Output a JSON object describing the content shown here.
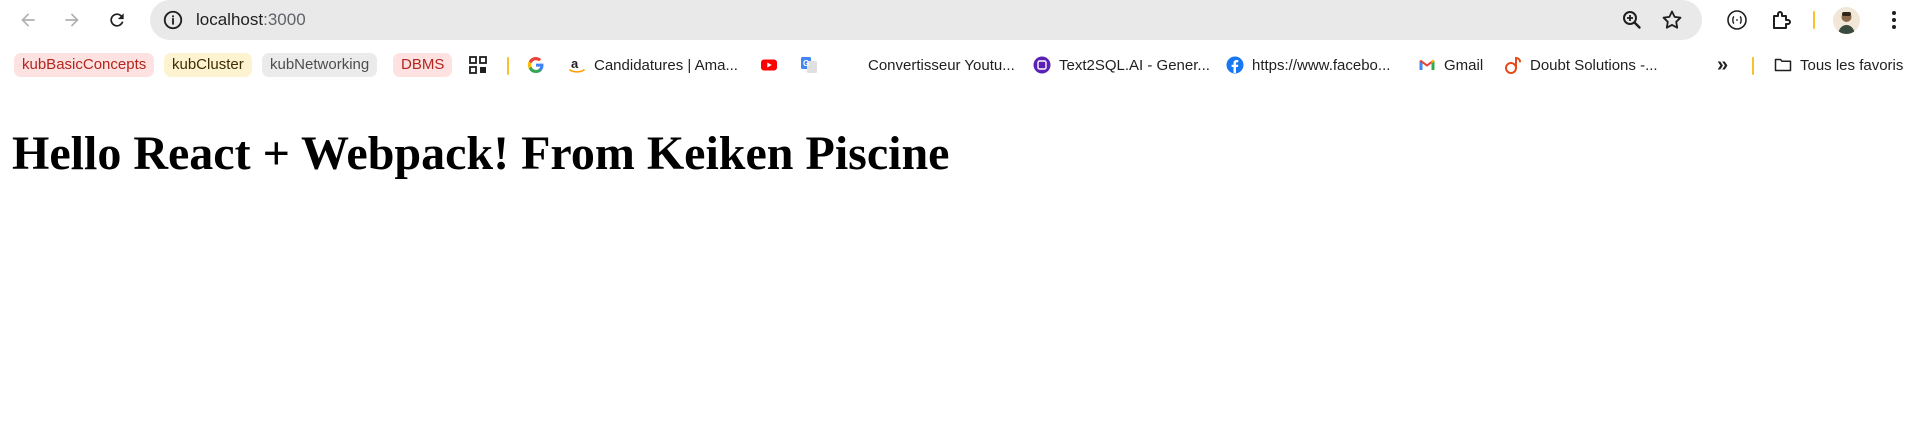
{
  "toolbar": {
    "url_host": "localhost",
    "url_port": ":3000"
  },
  "bookmarks": {
    "chips": [
      {
        "label": "kubBasicConcepts"
      },
      {
        "label": "kubCluster"
      },
      {
        "label": "kubNetworking"
      },
      {
        "label": "DBMS"
      }
    ],
    "items": [
      {
        "label": "Candidatures | Ama..."
      },
      {
        "label": "Convertisseur Youtu..."
      },
      {
        "label": "Text2SQL.AI - Gener..."
      },
      {
        "label": "https://www.facebo..."
      },
      {
        "label": "Gmail"
      },
      {
        "label": "Doubt Solutions -..."
      }
    ],
    "overflow_label": "»",
    "all_bookmarks_label": "Tous les favoris"
  },
  "page": {
    "heading": "Hello React + Webpack! From Keiken Piscine"
  },
  "colors": {
    "accent_separator": "#fbc02d",
    "chip_red_bg": "#fde2e1",
    "chip_yellow_bg": "#fef3d0",
    "chip_grey_bg": "#ebebeb"
  },
  "icons": [
    "back-arrow-icon",
    "forward-arrow-icon",
    "reload-icon",
    "site-info-icon",
    "zoom-icon",
    "star-icon",
    "tab-search-icon",
    "extensions-icon",
    "profile-avatar",
    "menu-dots-icon",
    "apps-grid-icon",
    "google-icon",
    "amazon-icon",
    "youtube-icon",
    "translate-icon",
    "text2sql-icon",
    "facebook-icon",
    "gmail-icon",
    "doubt-solutions-icon",
    "folder-icon"
  ]
}
